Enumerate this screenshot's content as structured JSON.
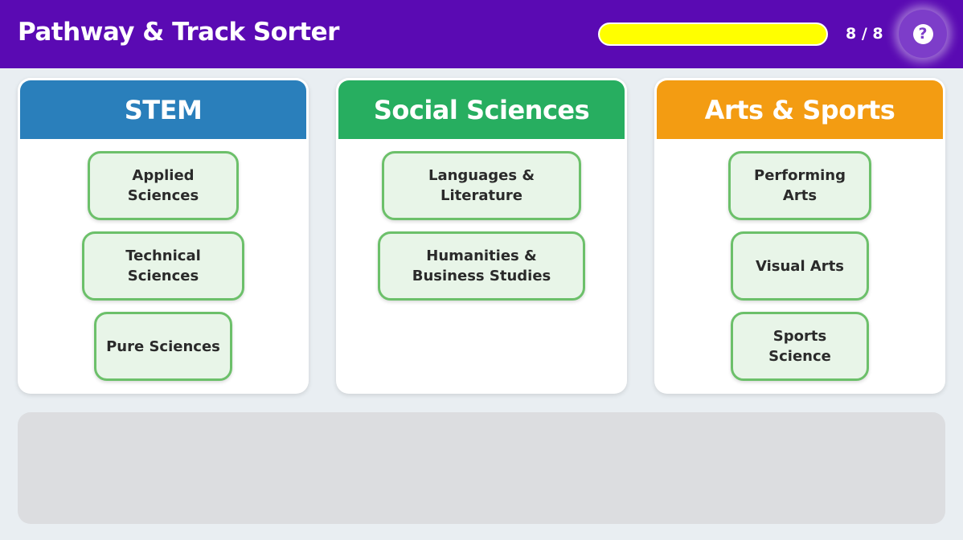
{
  "header": {
    "title": "Pathway & Track Sorter",
    "progress_fraction": 1.0,
    "progress_text": "8 / 8",
    "help_icon": "question-mark-icon",
    "help_glyph": "?",
    "colors": {
      "bar": "#5a0ab3",
      "progress_fill": "#ffff00"
    }
  },
  "categories": [
    {
      "title": "STEM",
      "color": "#2a7fbb",
      "cards": [
        "Applied Sciences",
        "Technical Sciences",
        "Pure Sciences"
      ]
    },
    {
      "title": "Social Sciences",
      "color": "#27ae60",
      "cards": [
        "Languages & Literature",
        "Humanities & Business Studies"
      ]
    },
    {
      "title": "Arts & Sports",
      "color": "#f39c12",
      "cards": [
        "Performing Arts",
        "Visual Arts",
        "Sports Science"
      ]
    }
  ],
  "card_colors": {
    "border": "#6cc06a",
    "fill": "#e8f5e8"
  }
}
